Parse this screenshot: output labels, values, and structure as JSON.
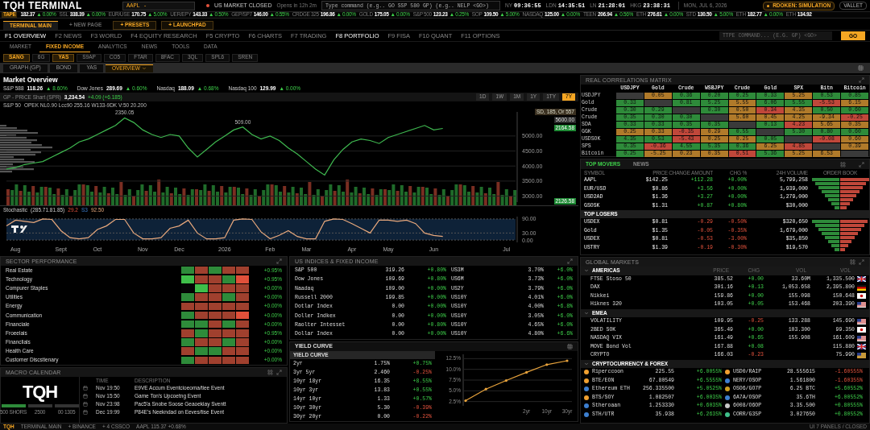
{
  "header": {
    "title": "TQH TERMINAL",
    "symbol_field": {
      "value": "AAPL -"
    },
    "market_status": {
      "text": "US MARKET CLOSED",
      "detail": "Opens in 12h 2m"
    },
    "command_field": {
      "placeholder": "Type command (e.g.. GO SSP 580 GP) (e.g.. NELP <GO>)"
    },
    "clocks": [
      {
        "city": "NY",
        "time": "09:36:55"
      },
      {
        "city": "LDN",
        "time": "14:35:51"
      },
      {
        "city": "LN",
        "time": "21:28:01"
      },
      {
        "city": "HKG",
        "time": "23:38:31"
      }
    ],
    "date": "MON, JUL 6, 2026",
    "mode_badge": "RDOKEN: SIMULATION",
    "wallet_button": "VALLET"
  },
  "ticker": {
    "label": "TAPE",
    "items": [
      {
        "price": "182.37",
        "change": "▲ 0.00%"
      },
      {
        "name": "SSL",
        "price": "338.39",
        "change": "▲ 0.00%"
      },
      {
        "name": "EUR/USE",
        "price": "170.75",
        "change": "▲ 5.00%"
      },
      {
        "name": "UER/EPY",
        "price": "143.33",
        "change": "▲ 0.50%"
      },
      {
        "name": "GEP/SP7",
        "price": "146.00",
        "change": "▲ 0.55%"
      },
      {
        "name": "CRDGE 325",
        "price": "196.86",
        "change": "▲ 0.00%"
      },
      {
        "name": "GOLD",
        "price": "175.05",
        "change": "▲ 0.00%"
      },
      {
        "name": "S&P 500",
        "price": "123.23",
        "change": "▲ 0.25%"
      },
      {
        "name": "SOP",
        "price": "109.50",
        "change": "▲ 5.00%"
      },
      {
        "name": "NASDAQ",
        "price": "125.00",
        "change": "▲ 0.00%"
      },
      {
        "name": "TEEN",
        "price": "206.94",
        "change": "▲ 0.56%"
      },
      {
        "name": "ETH",
        "price": "276.61",
        "change": "▲ 0.00%"
      },
      {
        "name": "STD",
        "price": "130.50",
        "change": "▲ 5.00%"
      },
      {
        "name": "ETH",
        "price": "182.77",
        "change": "▲ 0.00%"
      },
      {
        "name": "ETH",
        "price": "134.92"
      }
    ]
  },
  "page_tabs": [
    {
      "label": "TERMINAL MAIN",
      "kind": "tab",
      "selected": true
    },
    {
      "label": "+ NEW PAGE",
      "kind": "link",
      "selected": false
    },
    {
      "label": "+ PRESETS",
      "kind": "action",
      "selected": false
    },
    {
      "label": "+ LAUNCHPAD",
      "kind": "action",
      "selected": false
    }
  ],
  "function_keys": [
    {
      "key": "F1",
      "label": "OVERVIEW",
      "selected": true
    },
    {
      "key": "F2",
      "label": "NEWS",
      "selected": false
    },
    {
      "key": "F3",
      "label": "WORLD",
      "selected": false
    },
    {
      "key": "F4",
      "label": "EQUITY RESEARCH",
      "selected": false
    },
    {
      "key": "F5",
      "label": "CRYPTO",
      "selected": false
    },
    {
      "key": "F6",
      "label": "CHARTS",
      "selected": false
    },
    {
      "key": "F7",
      "label": "TRADING",
      "selected": false
    },
    {
      "key": "F8",
      "label": "PORTFOLIO",
      "selected": true
    },
    {
      "key": "F9",
      "label": "FISA",
      "selected": false
    },
    {
      "key": "F10",
      "label": "QUANT",
      "selected": false
    },
    {
      "key": "F11",
      "label": "OPTIONS",
      "selected": false
    }
  ],
  "quick_command": {
    "placeholder": "TTPE COMMAND... (E.G. GP) <GO>",
    "button": "GO"
  },
  "section_tabs": [
    {
      "label": "MARKET",
      "selected": false
    },
    {
      "label": "FIXED INCOME",
      "selected": true
    },
    {
      "label": "ANALYTICS",
      "selected": false
    },
    {
      "label": "NEWS",
      "selected": false
    },
    {
      "label": "TOOLS",
      "selected": false
    },
    {
      "label": "DATA",
      "selected": false
    }
  ],
  "function_buttons": [
    {
      "label": "SANG",
      "selected": true
    },
    {
      "label": "6G",
      "selected": false
    },
    {
      "label": "YAS",
      "selected": true
    },
    {
      "label": "S9AP",
      "selected": false
    },
    {
      "label": "CO5",
      "selected": false
    },
    {
      "label": "FTAR",
      "selected": false
    },
    {
      "label": "8FAC",
      "selected": false
    },
    {
      "label": "3QL",
      "selected": false
    },
    {
      "label": "SPL6",
      "selected": false
    },
    {
      "label": "SREN",
      "selected": false
    }
  ],
  "view_tabs": [
    {
      "label": "GRAPH (GP)",
      "selected": false
    },
    {
      "label": "BOND",
      "selected": false
    },
    {
      "label": "YAS",
      "selected": false
    },
    {
      "label": "OVERVIEW",
      "selected": true
    }
  ],
  "market_overview": {
    "title": "Market Overview",
    "indices": [
      {
        "name": "S&P 588",
        "value": "118.26",
        "change": "▲ 8.60%"
      },
      {
        "name": "Dow Jones",
        "value": "289.69",
        "change": "▲ 0.60%"
      },
      {
        "name": "Nasdaq",
        "value": "188.09",
        "change": "▲ 0.68%"
      },
      {
        "name": "Nasdaq 100",
        "value": "129.99",
        "change": "▲ 0.00%"
      }
    ]
  },
  "price_chart": {
    "title": "GP - PRICE Shart (SPR)",
    "price": "3,234.54",
    "change": "+4.09 (+6.185)",
    "ranges": [
      {
        "label": "1D",
        "selected": false
      },
      {
        "label": "1W",
        "selected": false
      },
      {
        "label": "1M",
        "selected": false
      },
      {
        "label": "1Y",
        "selected": false
      },
      {
        "label": "1TY",
        "selected": false
      },
      {
        "label": "7Y",
        "selected": true
      }
    ],
    "legend": "OPEK NL0.90 Lcc90 255.16 W133-9DK V:50 20.200",
    "peak_labels": [
      "2350.05",
      "509.00"
    ],
    "price_tags": [
      {
        "text": "SD, 185, Or 557",
        "kind": "note"
      },
      {
        "text": "5600.00",
        "kind": "level"
      },
      {
        "text": "2164.58",
        "kind": "last"
      },
      {
        "text": "2126.58",
        "kind": "last"
      }
    ],
    "chart_data": {
      "type": "line",
      "grid": true,
      "ylim": [
        2800,
        5800
      ],
      "categories": [
        null,
        null,
        null,
        null,
        null,
        null,
        null,
        null,
        null,
        null,
        null,
        null,
        null,
        null,
        null,
        null,
        null,
        null,
        null,
        null,
        null,
        null,
        null,
        null,
        null,
        null,
        null,
        null,
        null,
        null,
        null,
        null,
        null,
        null,
        null,
        null,
        null,
        null,
        null,
        null,
        null,
        null,
        null,
        null,
        null,
        null,
        null,
        null,
        null
      ],
      "yticks": [
        {
          "value": 3000,
          "label": "3000.00"
        },
        {
          "value": 3500,
          "label": "3500.00"
        },
        {
          "value": 4000,
          "label": "4000.00"
        },
        {
          "value": 4500,
          "label": "4500.00"
        },
        {
          "value": 5000,
          "label": "5000.00"
        }
      ],
      "series": [
        {
          "name": "S&P 50",
          "color": "#3fb950",
          "values": [
            3900,
            3950,
            4050,
            4100,
            4150,
            4300,
            4450,
            4600,
            4800,
            4900,
            5050,
            5200,
            5350,
            5600,
            5450,
            5200,
            5050,
            4950,
            5050,
            5000,
            4600,
            4300,
            4550,
            4800,
            5000,
            5200,
            5300,
            5050,
            4900,
            5000,
            4850,
            4600,
            4400,
            4150,
            3900,
            3700,
            4200,
            4550,
            4800,
            4900,
            4850,
            4750,
            4950,
            5050,
            5150,
            5250,
            5350,
            5200,
            5250
          ]
        }
      ]
    }
  },
  "stochastic": {
    "label": "(285.71.81.85)",
    "k": "29.2",
    "d_label": "S3",
    "d": "92.50",
    "chart_data": {
      "type": "line",
      "grid": true,
      "ylim": [
        -10,
        100
      ],
      "yticks": [
        {
          "value": 0,
          "label": "0.00"
        },
        {
          "value": 30,
          "label": "30.00"
        },
        {
          "value": 90,
          "label": "90.00"
        }
      ],
      "categories": [
        null,
        "Aug",
        null,
        null,
        null,
        null,
        "Sept",
        null,
        null,
        null,
        "Oct",
        null,
        null,
        null,
        null,
        "Nov",
        null,
        null,
        null,
        "Dec",
        null,
        null,
        null,
        null,
        "2026",
        null,
        null,
        null,
        null,
        "Feb",
        null,
        null,
        null,
        "Mar",
        null,
        null,
        null,
        null,
        "Apr",
        null,
        null,
        null,
        "May",
        null,
        null,
        null,
        null,
        "Jun",
        null,
        null,
        null,
        null,
        null,
        null,
        null,
        "Jul"
      ],
      "series": [
        {
          "name": "Stochastic",
          "color": "#e8a87c",
          "values": [
            60,
            85,
            80,
            75,
            90,
            88,
            40,
            10,
            5,
            10,
            45,
            60,
            88,
            88,
            30,
            5,
            5,
            10,
            50,
            60,
            85,
            30,
            5,
            5,
            10,
            85,
            90,
            88,
            35,
            5,
            20,
            40,
            15,
            5,
            5,
            80,
            90,
            88,
            70,
            50,
            30,
            85,
            85,
            80,
            85,
            70,
            30,
            20,
            15,
            null,
            null,
            null,
            null,
            null,
            null,
            null
          ]
        }
      ]
    }
  },
  "sector_performance": {
    "title": "SECTOR PERFORMANCE",
    "rows": [
      {
        "name": "Real Estate",
        "change": "+0.95%",
        "cells": [
          {
            "color": "#2e8b3a"
          },
          {
            "color": "#a0402e"
          },
          {
            "color": "#2e8b3a"
          },
          {
            "color": "#a0402e"
          },
          {
            "color": "#a0402e"
          }
        ]
      },
      {
        "name": "Technology",
        "change": "+0.95%",
        "cells": [
          {
            "color": "#3fbf4a"
          },
          {
            "color": "#a0402e"
          },
          {
            "color": "#a0402e"
          },
          {
            "color": "#2e8b3a"
          },
          {
            "color": "#e0503a"
          }
        ]
      },
      {
        "name": "Compurer Staples",
        "change": "+0.00%",
        "cells": [
          {
            "color": "#050505"
          },
          {
            "color": "#3fbf4a"
          },
          {
            "color": "#a0402e"
          },
          {
            "color": "#a0402e"
          },
          {
            "color": "#a0402e"
          }
        ]
      },
      {
        "name": "Utilities",
        "change": "+0.00%",
        "cells": [
          {
            "color": "#2e8b3a"
          },
          {
            "color": "#a0402e"
          },
          {
            "color": "#a0402e"
          },
          {
            "color": "#2e8b3a"
          },
          {
            "color": "#a0402e"
          }
        ]
      },
      {
        "name": "Energy",
        "change": "+0.00%",
        "cells": [
          {
            "color": "#a0402e"
          },
          {
            "color": "#a0402e"
          },
          {
            "color": "#a0402e"
          },
          {
            "color": "#a0402e"
          },
          {
            "color": "#a0402e"
          }
        ]
      },
      {
        "name": "Communication",
        "change": "+0.00%",
        "cells": [
          {
            "color": "#2e8b3a"
          },
          {
            "color": "#a0402e"
          },
          {
            "color": "#a0402e"
          },
          {
            "color": "#a0402e"
          },
          {
            "color": "#e0503a"
          }
        ]
      },
      {
        "name": "Financiale",
        "change": "+0.00%",
        "cells": [
          {
            "color": "#2e8b3a"
          },
          {
            "color": "#2e8b3a"
          },
          {
            "color": "#a0402e"
          },
          {
            "color": "#2e8b3a"
          },
          {
            "color": "#a0402e"
          }
        ]
      },
      {
        "name": "Froeelais",
        "change": "+0.95%",
        "cells": [
          {
            "color": "#a0402e"
          },
          {
            "color": "#2e8b3a"
          },
          {
            "color": "#a0402e"
          },
          {
            "color": "#a0402e"
          },
          {
            "color": "#a0402e"
          }
        ]
      },
      {
        "name": "Financlials",
        "change": "+0.00%",
        "cells": [
          {
            "color": "#2e8b3a"
          },
          {
            "color": "#a0402e"
          },
          {
            "color": "#a0402e"
          },
          {
            "color": "#2e8b3a"
          },
          {
            "color": "#a0402e"
          }
        ]
      },
      {
        "name": "Health Care",
        "change": "+0.00%",
        "cells": [
          {
            "color": "#a0402e"
          },
          {
            "color": "#2e8b3a"
          },
          {
            "color": "#2e8b3a"
          },
          {
            "color": "#a0402e"
          },
          {
            "color": "#a0402e"
          }
        ]
      },
      {
        "name": "Customer Discstienary",
        "change": "+0.00%",
        "cells": [
          {
            "color": "#2e8b3a"
          },
          {
            "color": "#a0402e"
          },
          {
            "color": "#a0402e"
          },
          {
            "color": "#a0402e"
          },
          {
            "color": "#a0402e"
          }
        ]
      }
    ]
  },
  "macro_calendar": {
    "title": "MACRO CALENDAR",
    "logo": "TQH",
    "stats": [
      {
        "label": "500 SHORS",
        "on": true
      },
      {
        "label": "2500",
        "on": false
      },
      {
        "label": "00 1305",
        "on": false
      }
    ],
    "columns": [
      "TIME",
      "DESCRIPTION"
    ],
    "events": [
      {
        "time": "Nov 19:50",
        "description": "E9VE Accum Eventcioeoma/tiee Event"
      },
      {
        "time": "Nov 15:50",
        "description": "Game Ton's Upcoetng Event"
      },
      {
        "time": "Nov 23:98",
        "description": "Pac5'a Snobe Soose Geaoekiay Sventt"
      },
      {
        "time": "Dec 19:99",
        "description": "P84E's Neekndad on Eeves/tise Event"
      }
    ]
  },
  "us_indices": {
    "title": "US INDICES & FIXED INCOME",
    "rows": [
      {
        "name": "S&P 500",
        "value": "319.26",
        "change": "+0.80%",
        "bond": "US3M",
        "yield": "3.70%",
        "bond_change": "+6.0%"
      },
      {
        "name": "Dow Jones",
        "value": "109.69",
        "change": "+0.80%",
        "bond": "US6M",
        "yield": "3.73%",
        "bond_change": "+6.0%"
      },
      {
        "name": "Naadaq",
        "value": "109.00",
        "change": "+0.00%",
        "bond": "US2Y",
        "yield": "3.79%",
        "bond_change": "+6.0%"
      },
      {
        "name": "Russell 2000",
        "value": "199.85",
        "change": "+0.00%",
        "bond": "US10Y",
        "yield": "4.01%",
        "bond_change": "+6.0%"
      },
      {
        "name": "Dotlar Index",
        "value": "0.00",
        "change": "+0.00%",
        "bond": "US10Y",
        "yield": "4.00%",
        "bond_change": "+6.8%"
      },
      {
        "name": "Doller Indkex",
        "value": "0.00",
        "change": "+0.00%",
        "bond": "US10Y",
        "yield": "3.05%",
        "bond_change": "+6.0%"
      },
      {
        "name": "Raolter Intesset",
        "value": "0.00",
        "change": "+0.80%",
        "bond": "US10Y",
        "yield": "4.65%",
        "bond_change": "+6.0%"
      },
      {
        "name": "Dollar Index",
        "value": "0.00",
        "change": "+0.00%",
        "bond": "US10Y",
        "yield": "4.80%",
        "bond_change": "+6.6%"
      }
    ]
  },
  "yield_curve": {
    "title": "YIELD CURVE",
    "table_title": "YIELD CURVE",
    "rows": [
      {
        "term": "2yr",
        "value": "1.75%",
        "change": "+0.75%"
      },
      {
        "term": "3yr 5yr",
        "value": "2.460",
        "change": "-0.25%"
      },
      {
        "term": "10yr 18yr",
        "value": "16.35",
        "change": "+8.55%"
      },
      {
        "term": "10yr 3yr",
        "value": "13.83",
        "change": "+0.55%"
      },
      {
        "term": "14yr 10yr",
        "value": "1.33",
        "change": "+0.57%"
      },
      {
        "term": "10yr 30yr",
        "value": "5.30",
        "change": "-0.39%"
      },
      {
        "term": "30yr 20yr",
        "value": "0.00",
        "change": "-0.22%"
      }
    ],
    "chart_data": {
      "type": "line",
      "grid": true,
      "ylim": [
        1.5,
        13.5
      ],
      "categories": [
        null,
        null,
        null,
        "2yr",
        "10yr",
        "30yr"
      ],
      "yticks": [
        {
          "value": 2.5,
          "label": "2.5%"
        },
        {
          "value": 5,
          "label": "5.0%"
        },
        {
          "value": 7.5,
          "label": "7.5%"
        },
        {
          "value": 10,
          "label": "10.0%"
        },
        {
          "value": 12.5,
          "label": "12.5%"
        }
      ],
      "series": [
        {
          "color": "#e8a33c",
          "values": [
            2.7,
            5.4,
            7.4,
            9.3,
            11.1,
            12.0
          ]
        }
      ]
    }
  },
  "correlation_matrix": {
    "title": "REAL CORRELATIONS MATRIX",
    "columns": [
      "USDJPY",
      "Gold",
      "Crude",
      "WSBJPY",
      "Crude",
      "Gold",
      "SPX",
      "Bitn",
      "Bitcoin"
    ],
    "rows": [
      {
        "label": "USDJPY",
        "cells": [
          {
            "color": "#3a3a3a"
          },
          {
            "text": "0.05",
            "color": "#b07a2a"
          },
          {
            "text": "0.36",
            "color": "#2e8b3a"
          },
          {
            "text": "0.20",
            "color": "#2e8b3a"
          },
          {
            "text": "0.25",
            "color": "#2e8b3a"
          },
          {
            "text": "0.33",
            "color": "#2e8b3a"
          },
          {
            "text": "5.25",
            "color": "#b07a2a"
          },
          {
            "text": "0.53",
            "color": "#2e8b3a"
          },
          {
            "text": "0.85",
            "color": "#2e8b3a"
          }
        ]
      },
      {
        "label": "Gold",
        "cells": [
          {
            "text": "0.33",
            "color": "#2e8b3a"
          },
          {
            "color": "#3a3a3a"
          },
          {
            "text": "0.81",
            "color": "#2e8b3a"
          },
          {
            "text": "5.25",
            "color": "#2e8b3a"
          },
          {
            "text": "5.55",
            "color": "#b07a2a"
          },
          {
            "text": "6.06",
            "color": "#2e8b3a"
          },
          {
            "text": "5.55",
            "color": "#2e8b3a"
          },
          {
            "text": "-5.53",
            "color": "#c0473a"
          },
          {
            "text": "6.15",
            "color": "#b07a2a"
          }
        ]
      },
      {
        "label": "Crude",
        "cells": [
          {
            "text": "0.30",
            "color": "#2e8b3a"
          },
          {
            "text": "0.29",
            "color": "#2e8b3a"
          },
          {
            "color": "#3a3a3a"
          },
          {
            "text": "0.30",
            "color": "#2e8b3a"
          },
          {
            "text": "0.50",
            "color": "#b07a2a"
          },
          {
            "text": "0.34",
            "color": "#c0473a"
          },
          {
            "text": "4.35",
            "color": "#b07a2a"
          },
          {
            "text": "0.50",
            "color": "#2e8b3a"
          },
          {
            "text": "0.60",
            "color": "#2e8b3a"
          }
        ]
      },
      {
        "label": "Crude",
        "cells": [
          {
            "text": "0.35",
            "color": "#2e8b3a"
          },
          {
            "text": "0.30",
            "color": "#2e8b3a"
          },
          {
            "text": "0.30",
            "color": "#2e8b3a"
          },
          {
            "color": "#3a3a3a"
          },
          {
            "text": "5.60",
            "color": "#b07a2a"
          },
          {
            "text": "0.45",
            "color": "#b07a2a"
          },
          {
            "text": "4.25",
            "color": "#b07a2a"
          },
          {
            "text": "-9.34",
            "color": "#b07a2a"
          },
          {
            "text": "-0.25",
            "color": "#c0473a"
          }
        ]
      },
      {
        "label": "SDA",
        "cells": [
          {
            "text": "0.33",
            "color": "#2e8b3a"
          },
          {
            "text": "0.33",
            "color": "#2e8b3a"
          },
          {
            "text": "0.35",
            "color": "#2e8b3a"
          },
          {
            "text": "0.35",
            "color": "#2e8b3a"
          },
          {
            "color": "#3a3a3a"
          },
          {
            "text": "0.13",
            "color": "#2e8b3a"
          },
          {
            "text": "4.23",
            "color": "#c0473a"
          },
          {
            "text": "5.65",
            "color": "#b07a2a"
          },
          {
            "text": "0.35",
            "color": "#b07a2a"
          }
        ]
      },
      {
        "label": "GGK",
        "cells": [
          {
            "text": "0.25",
            "color": "#b07a2a"
          },
          {
            "text": "0.33",
            "color": "#b07a2a"
          },
          {
            "text": "-0.35",
            "color": "#c0473a"
          },
          {
            "text": "0.29",
            "color": "#b07a2a"
          },
          {
            "text": "0.55",
            "color": "#2e8b3a"
          },
          {
            "color": "#3a3a3a"
          },
          {
            "text": "5.30",
            "color": "#2e8b3a"
          },
          {
            "text": "0.80",
            "color": "#2e8b3a"
          },
          {
            "text": "0.60",
            "color": "#2e8b3a"
          }
        ]
      },
      {
        "label": "USDSOK",
        "cells": [
          {
            "text": "4.35",
            "color": "#2e8b3a"
          },
          {
            "text": "0.53",
            "color": "#2e8b3a"
          },
          {
            "text": "-5.43",
            "color": "#c0473a"
          },
          {
            "text": "0.25",
            "color": "#b07a2a"
          },
          {
            "text": "0.25",
            "color": "#b07a2a"
          },
          {
            "text": "0.05",
            "color": "#2e8b3a"
          },
          {
            "color": "#3a3a3a"
          },
          {
            "text": "-0.08",
            "color": "#c0473a"
          },
          {
            "text": "0.60",
            "color": "#b07a2a"
          }
        ]
      },
      {
        "label": "SPS",
        "cells": [
          {
            "text": "0.35",
            "color": "#2e8b3a"
          },
          {
            "text": "-0.36",
            "color": "#c0473a"
          },
          {
            "text": "4.55",
            "color": "#2e8b3a"
          },
          {
            "text": "5.35",
            "color": "#2e8b3a"
          },
          {
            "text": "0.36",
            "color": "#2e8b3a"
          },
          {
            "text": "6.25",
            "color": "#b07a2a"
          },
          {
            "text": "4.85",
            "color": "#c0473a"
          },
          {
            "color": "#3a3a3a"
          },
          {
            "text": "0.39",
            "color": "#b07a2a"
          }
        ]
      },
      {
        "label": "Bitcoin",
        "cells": [
          {
            "text": "0.25",
            "color": "#2e8b3a"
          },
          {
            "text": "-5.25",
            "color": "#b07a2a"
          },
          {
            "text": "0.23",
            "color": "#b07a2a"
          },
          {
            "text": "0.35",
            "color": "#b07a2a"
          },
          {
            "text": "0.51",
            "color": "#c0473a"
          },
          {
            "text": "5.36",
            "color": "#2e8b3a"
          },
          {
            "text": "5.25",
            "color": "#b07a2a"
          },
          {
            "text": "6.53",
            "color": "#b07a2a"
          },
          {
            "color": "#3a3a3a"
          }
        ]
      }
    ]
  },
  "movers": {
    "tabs": [
      {
        "label": "TOP MOVERS",
        "selected": true
      },
      {
        "label": "NEWS",
        "selected": false
      }
    ],
    "columns": [
      "SYMBOL",
      "PRICE",
      "CHANGE AMOUNT",
      "CHG %",
      "24H VOLUME",
      "ORDER BOOK"
    ],
    "gainers": [
      {
        "symbol": "AAPL",
        "price": "$142.25",
        "change": "+112.28",
        "pct": "+0.00%",
        "volume": "5,799,258"
      },
      {
        "symbol": "EUR/USD",
        "price": "$0.86",
        "change": "+3.56",
        "pct": "+0.00%",
        "volume": "1,939,000"
      },
      {
        "symbol": "USD2AD",
        "price": "$1.36",
        "change": "+3.27",
        "pct": "+0.00%",
        "volume": "1,279,000"
      },
      {
        "symbol": "GSOSK",
        "price": "$1.31",
        "change": "+0.87",
        "pct": "+0.80%",
        "volume": "$30,000"
      }
    ],
    "losers_title": "TOP LOSERS",
    "losers": [
      {
        "symbol": "USDEX",
        "price": "$0.81",
        "change": "-0.29",
        "pct": "-0.50%",
        "volume": "$320,650"
      },
      {
        "symbol": "Gold",
        "price": "$1.35",
        "change": "-0.05",
        "pct": "-0.35%",
        "volume": "1,679,000"
      },
      {
        "symbol": "USDEX",
        "price": "$0.81",
        "change": "-0.53",
        "pct": "-3.00%",
        "volume": "$35,850"
      },
      {
        "symbol": "USTRY",
        "price": "$1.39",
        "change": "-0.19",
        "pct": "-0.30%",
        "volume": "$19,570"
      }
    ]
  },
  "global_markets": {
    "title": "GLOBAL MARKETS",
    "columns": [
      "PRICE",
      "CHG",
      "VOL",
      "VOL"
    ],
    "groups": [
      {
        "name": "AMERICAS",
        "expanded": true,
        "rows": [
          {
            "name": "FTSE Stoso 50",
            "price": "385.52",
            "change": "+0.00",
            "vol": "33.60M",
            "vol2": "1,335.500",
            "kind": "gb"
          },
          {
            "name": "DAX",
            "price": "301.16",
            "change": "+0.13",
            "vol": "1,053.658",
            "vol2": "2,395.800",
            "kind": "de"
          },
          {
            "name": "Nikkei",
            "price": "159.86",
            "change": "+0.00",
            "vol": "155.098",
            "vol2": "150.648",
            "kind": "jp"
          },
          {
            "name": "Hiknes 320",
            "price": "103.05",
            "change": "+0.05",
            "vol": "153.468",
            "vol2": "203.390",
            "kind": "us"
          }
        ]
      },
      {
        "name": "EMEA",
        "expanded": true,
        "rows": [
          {
            "name": "VOLATILITY",
            "price": "109.95",
            "change": "-0.25",
            "vol": "133.288",
            "vol2": "145.690",
            "kind": "us"
          },
          {
            "name": "2BED SOK",
            "price": "365.49",
            "change": "+0.00",
            "vol": "103.300",
            "vol2": "99.350",
            "kind": "jp"
          },
          {
            "name": "NASDAQ VIX",
            "price": "161.49",
            "change": "+0.65",
            "vol": "155.908",
            "vol2": "161.609",
            "kind": "us"
          },
          {
            "name": "MOVE Bond Vol",
            "price": "167.88",
            "change": "+0.08",
            "vol2": "115.880",
            "kind": "gb"
          },
          {
            "name": "CRYPTO",
            "price": "166.03",
            "change": "-0.23",
            "vol2": "75.990",
            "kind": "au"
          }
        ]
      }
    ],
    "crypto": {
      "name": "CRYPTOCURRENCY & FOREX",
      "expanded": true,
      "pairs": [
        {
          "left": {
            "name": "Riperccoon",
            "price": "225.55",
            "change": "+6.0055%",
            "color": "#f0a030"
          },
          "right": {
            "name": "USD0/RAIP",
            "price": "28.555615",
            "change": "-1.60555%",
            "color": "#f0a030"
          }
        },
        {
          "left": {
            "name": "BTE/EON",
            "price": "67.80549",
            "change": "+6.5555%",
            "color": "#f0a030"
          },
          "right": {
            "name": "NERY/OSOP",
            "price": "1.561800",
            "change": "-1.60355%",
            "color": "#3d7fd0"
          }
        },
        {
          "left": {
            "name": "Ethereum ETH",
            "price": "256.335500",
            "change": "+5.0525%",
            "color": "#3d7fd0"
          },
          "right": {
            "name": "OSO6/GO7P",
            "price": "6.25 BTC",
            "change": "+5.60552%",
            "color": "#d0a020"
          }
        },
        {
          "left": {
            "name": "BTS/SOY",
            "price": "1.082507",
            "change": "+6.0035%",
            "color": "#f0a030"
          },
          "right": {
            "name": "6A7A/OSOP",
            "price": "35.6TH",
            "change": "+6.00552%",
            "color": "#3d7fd0"
          }
        },
        {
          "left": {
            "name": "Stheroaan",
            "price": "1.253330",
            "change": "+0.6035%",
            "color": "#3d7fd0"
          },
          "right": {
            "name": "6008/O6OP",
            "price": "3.35.500",
            "change": "+0.80555%",
            "color": "#c8c8c8"
          }
        },
        {
          "left": {
            "name": "STH/UTR",
            "price": "35.938",
            "change": "+6.2635%",
            "color": "#3d7fd0"
          },
          "right": {
            "name": "CORR/G35P",
            "price": "3.027650",
            "change": "+0.80552%",
            "color": "#3fbf8a"
          }
        }
      ]
    }
  },
  "status_bar": {
    "items": [
      "TQH",
      "TERMINAL MAIN",
      "+ BINANCE",
      "+ 4 CSSCO",
      "AAPL 115.37 +0.68%"
    ],
    "right": "UI 7 PANELS / CLOSED"
  }
}
